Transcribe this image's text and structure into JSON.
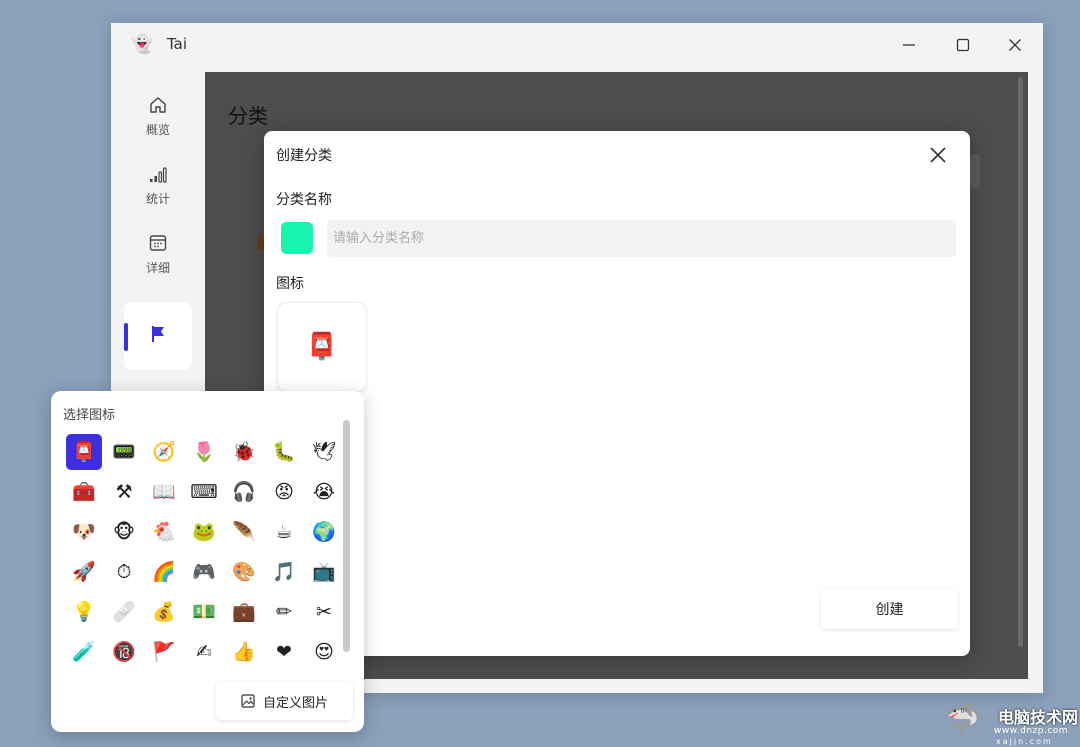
{
  "colors": {
    "background": "#8aa0bb",
    "accent": "#3b2fe0",
    "category_color": "#19f5b0"
  },
  "window": {
    "app_icon": "ghost-icon",
    "title": "Tai",
    "controls": [
      "minimize-icon",
      "maximize-icon",
      "close-icon"
    ]
  },
  "sidebar": {
    "items": [
      {
        "label": "概览",
        "icon": "home-icon"
      },
      {
        "label": "统计",
        "icon": "bar-chart-icon"
      },
      {
        "label": "详细",
        "icon": "calendar-icon"
      },
      {
        "label": "",
        "icon": "flag-icon",
        "active": true
      }
    ]
  },
  "page": {
    "title": "分类"
  },
  "dialog": {
    "title": "创建分类",
    "name_label": "分类名称",
    "name_placeholder": "请输入分类名称",
    "name_value": "",
    "icon_label": "图标",
    "selected_icon": "📮",
    "create_label": "创建"
  },
  "picker": {
    "title": "选择图标",
    "icons": [
      "📮",
      "📟",
      "🧭",
      "🌷",
      "🐞",
      "🐛",
      "🕊",
      "🧰",
      "⚒",
      "📖",
      "⌨",
      "🎧",
      "😡",
      "😭",
      "🐶",
      "🐵",
      "🐔",
      "🐸",
      "🪶",
      "☕",
      "🌍",
      "🚀",
      "⏱",
      "🌈",
      "🎮",
      "🎨",
      "🎵",
      "📺",
      "💡",
      "🩹",
      "💰",
      "💵",
      "💼",
      "✏",
      "✂",
      "🧪",
      "🔞",
      "🚩",
      "✍",
      "👍",
      "❤",
      "😍"
    ],
    "selected_index": 0,
    "custom_label": "自定义图片"
  },
  "watermark": {
    "name": "电脑技术网",
    "url": "www.dnzp.com",
    "sub": "xajjn.com"
  }
}
